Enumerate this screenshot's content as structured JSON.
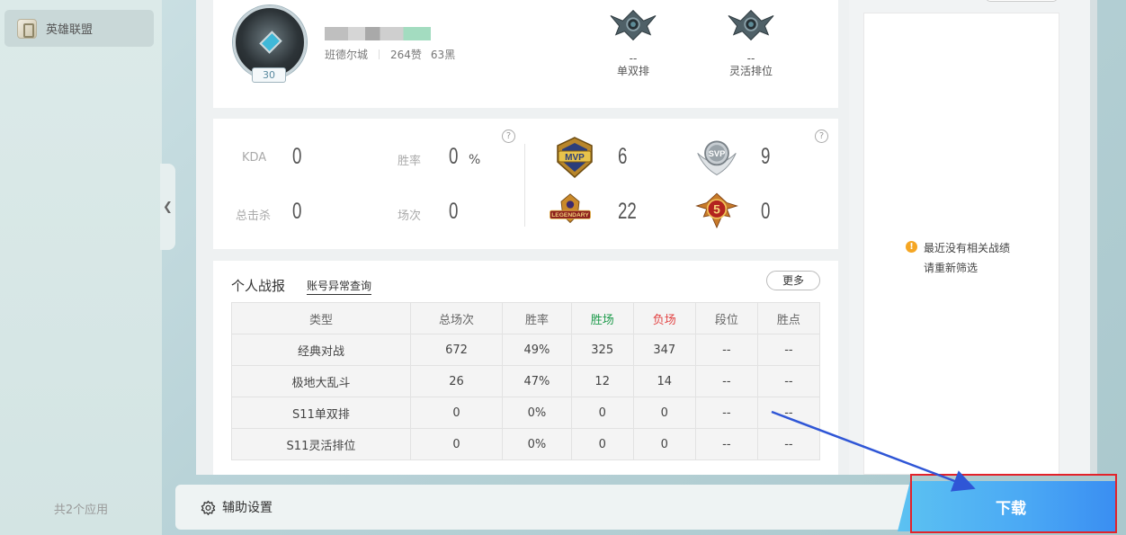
{
  "sidebar": {
    "app_label": "英雄联盟",
    "app_count": "共2个应用",
    "collapse_glyph": "❮"
  },
  "profile": {
    "level": "30",
    "server": "班德尔城",
    "likes": "264赞",
    "blacks": "63黑",
    "ranks": [
      {
        "value": "--",
        "label": "单双排"
      },
      {
        "value": "--",
        "label": "灵活排位"
      }
    ]
  },
  "stats": {
    "kda_label": "KDA",
    "kda_value": "0",
    "winrate_label": "胜率",
    "winrate_value": "0",
    "winrate_unit": "%",
    "kills_label": "总击杀",
    "kills_value": "0",
    "games_label": "场次",
    "games_value": "0",
    "help": "?",
    "badges": [
      {
        "name": "mvp-badge-icon",
        "text": "MVP",
        "count": "6"
      },
      {
        "name": "svp-badge-icon",
        "text": "SVP",
        "count": "9"
      },
      {
        "name": "legendary-badge-icon",
        "text": "LEGENDARY",
        "count": "22"
      },
      {
        "name": "pentakill-badge-icon",
        "text": "5",
        "count": "0"
      }
    ]
  },
  "records": {
    "title": "个人战报",
    "abnormal_link": "账号异常查询",
    "more_button": "更多",
    "headers": [
      "类型",
      "总场次",
      "胜率",
      "胜场",
      "负场",
      "段位",
      "胜点"
    ],
    "rows": [
      [
        "经典对战",
        "672",
        "49%",
        "325",
        "347",
        "--",
        "--"
      ],
      [
        "极地大乱斗",
        "26",
        "47%",
        "12",
        "14",
        "--",
        "--"
      ],
      [
        "S11单双排",
        "0",
        "0%",
        "0",
        "0",
        "--",
        "--"
      ],
      [
        "S11灵活排位",
        "0",
        "0%",
        "0",
        "0",
        "--",
        "--"
      ]
    ]
  },
  "right_panel": {
    "notice_line1": "最近没有相关战绩",
    "notice_line2": "请重新筛选"
  },
  "bottom": {
    "assist_settings": "辅助设置",
    "download": "下载"
  },
  "colors": {
    "win": "#1f9b4c",
    "loss": "#e24444",
    "download_gradient_start": "#5cc2f2",
    "download_gradient_end": "#3a8ef2",
    "highlight": "#e3222a",
    "arrow": "#2f56d6"
  }
}
